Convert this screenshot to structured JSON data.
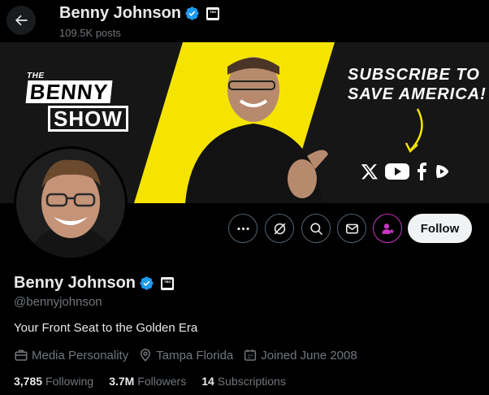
{
  "header": {
    "name": "Benny Johnson",
    "posts": "109.5K posts"
  },
  "banner": {
    "logo_the": "THE",
    "logo_benny": "BENNY",
    "logo_show": "SHOW",
    "cta_line1": "SUBSCRIBE TO",
    "cta_line2": "SAVE AMERICA!",
    "social_icons": [
      "x-logo-icon",
      "youtube-icon",
      "facebook-icon",
      "rumble-icon"
    ]
  },
  "actions": {
    "more": "more-icon",
    "grok": "grok-icon",
    "search": "search-icon",
    "message": "mail-icon",
    "subscribe": "subscribe-icon",
    "follow_label": "Follow"
  },
  "profile": {
    "name": "Benny Johnson",
    "handle": "@bennyjohnson",
    "bio": "Your Front Seat to the Golden Era",
    "category": "Media Personality",
    "location": "Tampa Florida",
    "joined": "Joined June 2008",
    "following_count": "3,785",
    "following_label": "Following",
    "followers_count": "3.7M",
    "followers_label": "Followers",
    "subscriptions_count": "14",
    "subscriptions_label": "Subscriptions"
  },
  "colors": {
    "background": "#000000",
    "verified": "#1d9bf0",
    "banner_yellow": "#f5e400",
    "subscribe_accent": "#c936c4",
    "muted": "#71767b"
  }
}
